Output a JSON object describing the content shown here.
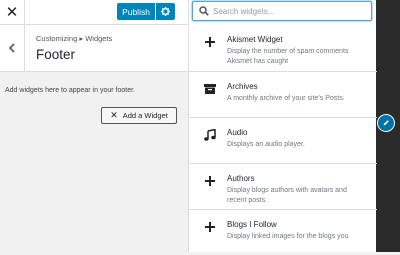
{
  "topbar": {
    "close_icon": "close-icon",
    "publish_label": "Publish",
    "settings_icon": "gear-icon"
  },
  "section": {
    "breadcrumb": "Customizing ▸ Widgets",
    "title": "Footer",
    "back_icon": "chevron-left-icon"
  },
  "hint": "Add widgets here to appear in your footer.",
  "add_widget_label": "Add a Widget",
  "search": {
    "placeholder": "Search widgets...",
    "value": ""
  },
  "widgets": [
    {
      "name": "Akismet Widget",
      "desc": "Display the number of spam comments Akismet has caught",
      "icon": "plus-icon"
    },
    {
      "name": "Archives",
      "desc": "A monthly archive of your site's Posts.",
      "icon": "archive-icon"
    },
    {
      "name": "Audio",
      "desc": "Displays an audio player.",
      "icon": "music-icon"
    },
    {
      "name": "Authors",
      "desc": "Display blogs authors with avatars and recent posts.",
      "icon": "plus-icon"
    },
    {
      "name": "Blogs I Follow",
      "desc": "Display linked images for the blogs you",
      "icon": "plus-icon"
    }
  ],
  "colors": {
    "accent": "#0085ba",
    "focus": "#5b9dd9",
    "preview_bg": "#2b2b2b"
  }
}
